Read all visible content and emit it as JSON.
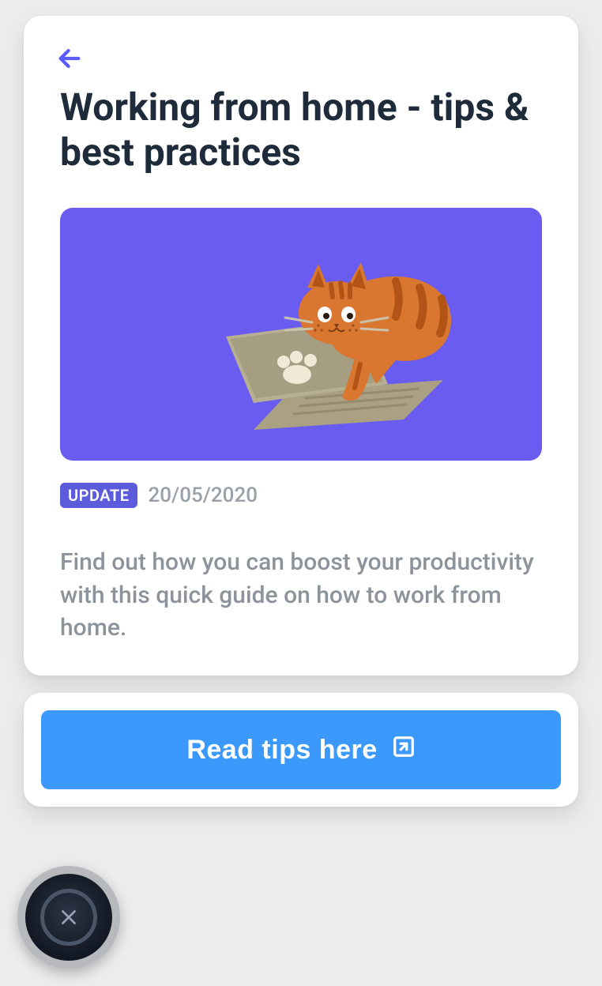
{
  "article": {
    "title": "Working from home - tips & best practices",
    "badge": "UPDATE",
    "date": "20/05/2020",
    "description": "Find out how you can boost your productivity with this quick guide on how to work from home."
  },
  "cta": {
    "label": "Read tips here"
  }
}
